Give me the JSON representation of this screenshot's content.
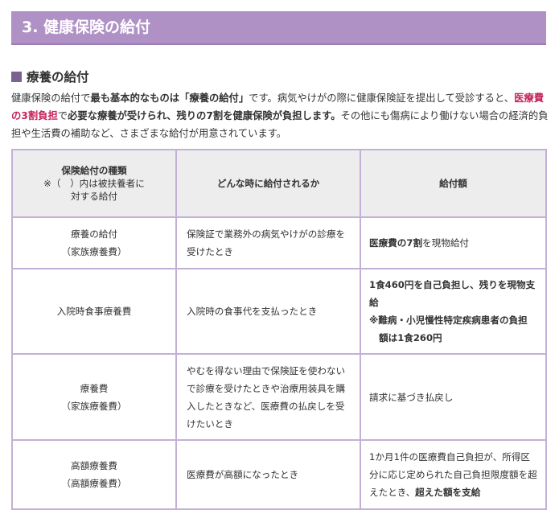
{
  "page_heading": "3. 健康保険の給付",
  "section": {
    "icon": "square-bullet-icon",
    "title": "療養の給付"
  },
  "intro": {
    "p1": "健康保険の給付で",
    "b1": "最も基本的なものは「療養の給付」",
    "p2": "です。病気やけがの際に健康保険証を提出して受診すると、",
    "b2": "医療費の3割負担",
    "p3": "で",
    "b3": "必要な療養が受けられ、残りの7割を健康保険が負担します。",
    "p4": "その他にも傷病により働けない場合の経済的負担や生活費の補助など、さまざまな給付が用意されています。"
  },
  "table": {
    "headers": {
      "type_title": "保険給付の種類",
      "type_note1": "※（　）内は被扶養者に",
      "type_note2": "対する給付",
      "when": "どんな時に給付されるか",
      "amount": "給付額"
    },
    "rows": [
      {
        "name": "療養の給付",
        "dep": "（家族療養費）",
        "when": "保険証で業務外の病気やけがの診療を受けたとき",
        "amt_b1": "医療費の7割",
        "amt_p1": "を現物給付"
      },
      {
        "name": "入院時食事療養費",
        "when": "入院時の食事代を支払ったとき",
        "amt_b1": "1食460円を自己負担し、残りを現物支給",
        "amt_b2a": "※難病・小児慢性特定疾病患者の負担",
        "amt_b2b": "額は1食260円"
      },
      {
        "name": "療養費",
        "dep": "（家族療養費）",
        "when": "やむを得ない理由で保険証を使わないで診療を受けたときや治療用装具を購入したときなど、医療費の払戻しを受けたいとき",
        "amt_p1": "請求に基づき払戻し"
      },
      {
        "name": "高額療養費",
        "dep": "（高額療養費）",
        "when": "医療費が高額になったとき",
        "amt_p1": "1か月1件の医療費自己負担が、所得区分に応じ定められた自己負担限度額を超えたとき、",
        "amt_b1": "超えた額を支給"
      }
    ]
  }
}
